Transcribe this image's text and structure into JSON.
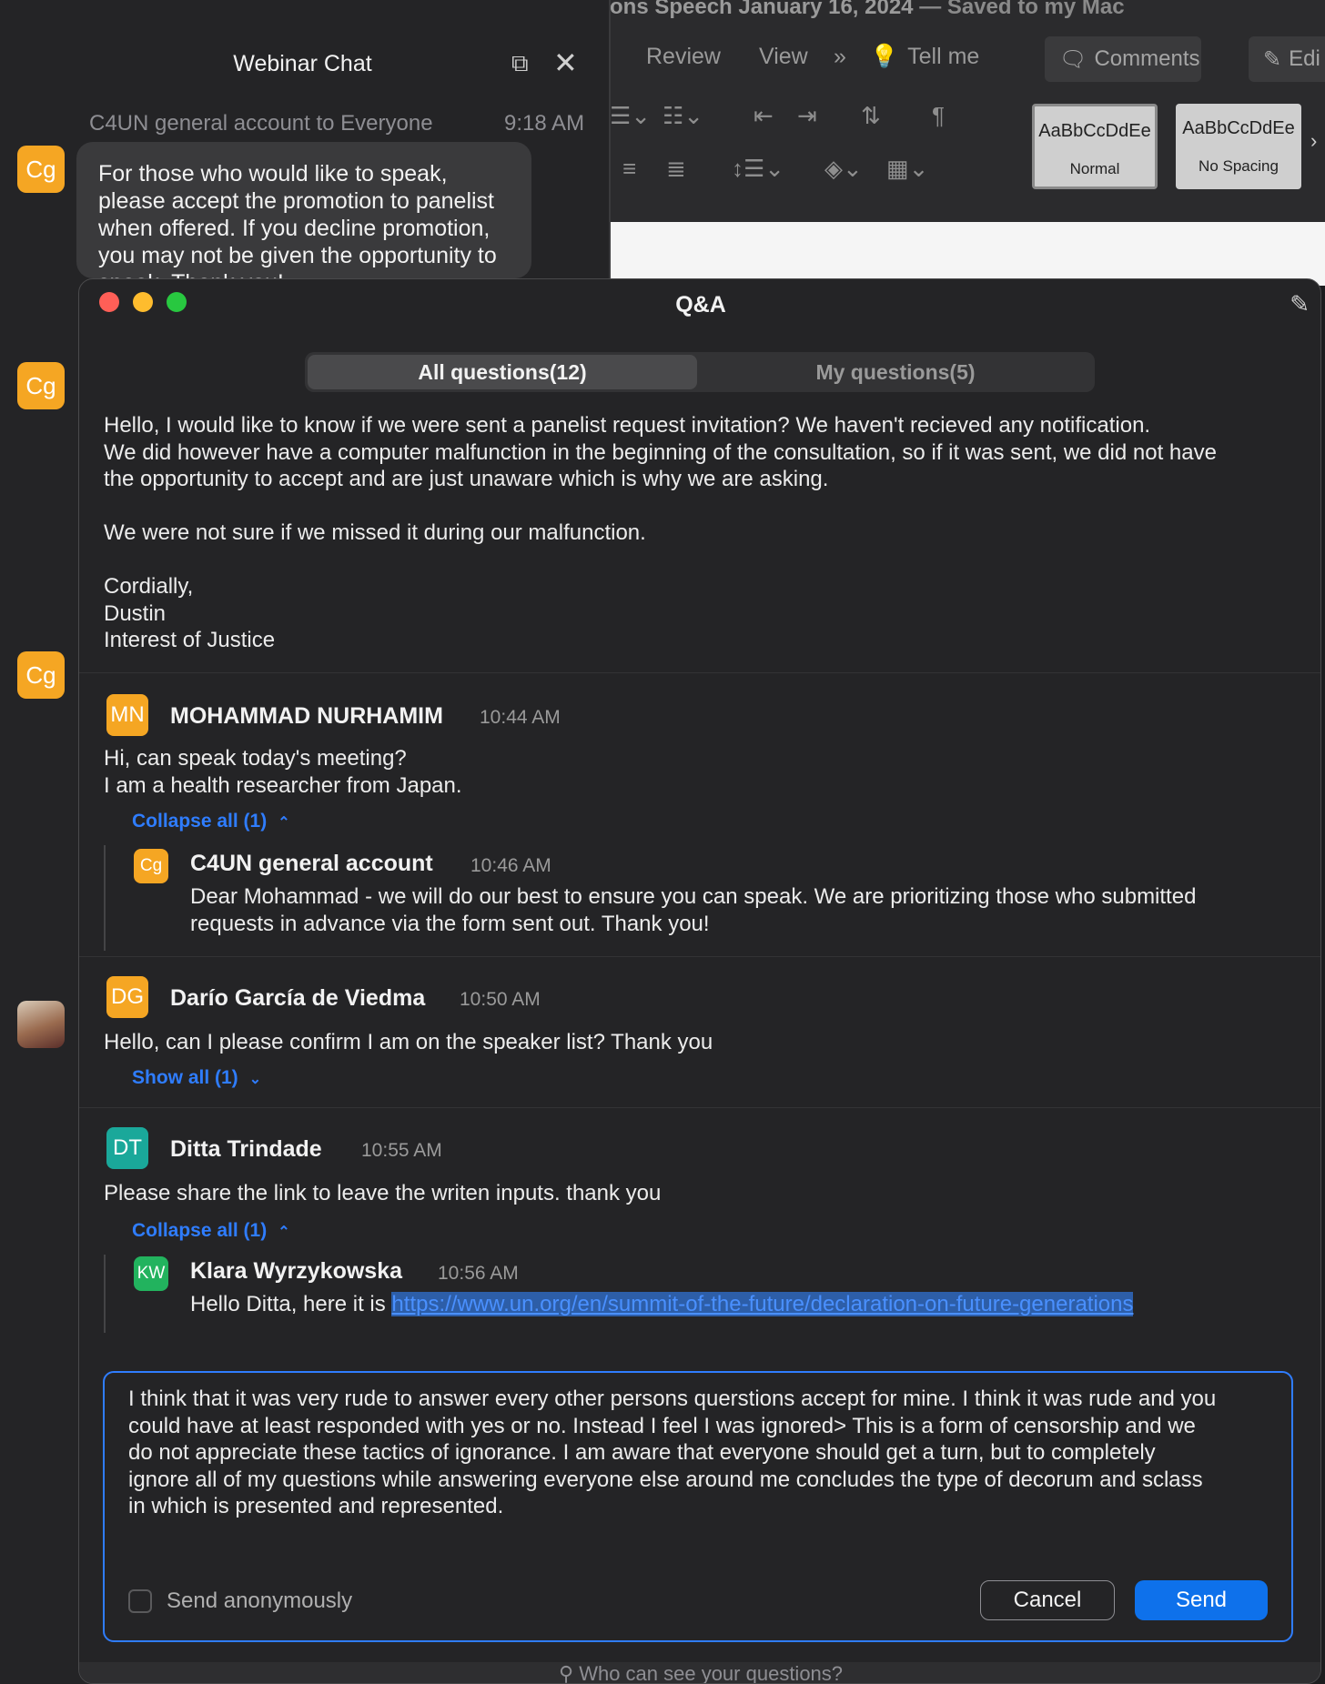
{
  "colors": {
    "accent": "#0e71eb",
    "link": "#4a90ff",
    "cg_avatar": "#f5a623",
    "mn_avatar": "#f5a623",
    "dg_avatar": "#f5a623",
    "dt_avatar": "#1aa89a",
    "kw_avatar": "#22b35e",
    "close_red": "#ff5f57",
    "minimize_yellow": "#febc2e",
    "zoom_green": "#28c840"
  },
  "word": {
    "title_left": "ons Speech January 16, 2024",
    "title_right": "— Saved to my Mac",
    "tabs": [
      "Review",
      "View",
      "Tell me"
    ],
    "overflow_icon": "double-chevron-icon",
    "comments_label": "Comments",
    "edit_label": "Edi",
    "styles": [
      {
        "preview": "AaBbCcDdEe",
        "label": "Normal"
      },
      {
        "preview": "AaBbCcDdEe",
        "label": "No Spacing"
      }
    ]
  },
  "chat": {
    "title": "Webinar Chat",
    "from": "C4UN general account to Everyone",
    "time": "9:18 AM",
    "message": "For those who would like to speak, please accept the promotion to panelist when offered. If you decline promotion, you may not be given the opportunity to speak. Thank you!",
    "avatar_initials": "Cg"
  },
  "qa": {
    "title": "Q&A",
    "tabs": {
      "all": "All questions(12)",
      "mine": "My questions(5)"
    },
    "q1": {
      "lines": [
        "Hello, I would like to know if we were sent a panelist request invitation? We haven't recieved any notification.",
        "We did however have a computer malfunction in the beginning of the consultation, so if it was sent, we did not have",
        "the opportunity to accept and are just unaware which is why we are asking.",
        "",
        "We were not sure if we missed it during our malfunction.",
        "",
        "Cordially,",
        "Dustin",
        "Interest of Justice"
      ]
    },
    "q2": {
      "initials": "MN",
      "name": "MOHAMMAD NURHAMIM",
      "time": "10:44 AM",
      "lines": [
        "Hi, can speak today's meeting?",
        "I am a health researcher from Japan."
      ],
      "toggle": "Collapse all (1)",
      "reply": {
        "initials": "Cg",
        "name": "C4UN general account",
        "time": "10:46 AM",
        "lines": [
          "Dear Mohammad - we will do our best to ensure you can speak. We are prioritizing those who submitted",
          "requests in advance via the form sent out. Thank you!"
        ]
      }
    },
    "q3": {
      "initials": "DG",
      "name": "Darío García de Viedma",
      "time": "10:50 AM",
      "text": "Hello, can I please confirm I am on the speaker list? Thank you",
      "toggle": "Show all (1)"
    },
    "q4": {
      "initials": "DT",
      "name": "Ditta Trindade",
      "time": "10:55 AM",
      "text": "Please share the link to leave the writen inputs. thank you",
      "toggle": "Collapse all (1)",
      "reply": {
        "initials": "KW",
        "name": "Klara Wyrzykowska",
        "time": "10:56 AM",
        "text": "Hello Ditta, here it is ",
        "link": "https://www.un.org/en/summit-of-the-future/declaration-on-future-generations"
      }
    },
    "compose": {
      "lines": [
        "I think that it was very rude to answer every other persons querstions accept for mine. I think it was rude and you",
        "could have at least responded with yes or no. Instead I feel I was ignored> This is a form of censorship and we",
        "do not appreciate these tactics of ignorance. I am aware that everyone should get a turn, but to completely",
        "ignore all of my questions while answering everyone else around me concludes the type of decorum and sclass",
        "in which is presented and represented."
      ],
      "anonymous_label": "Send anonymously",
      "cancel_label": "Cancel",
      "send_label": "Send"
    },
    "footer": "Who can see your questions?"
  }
}
